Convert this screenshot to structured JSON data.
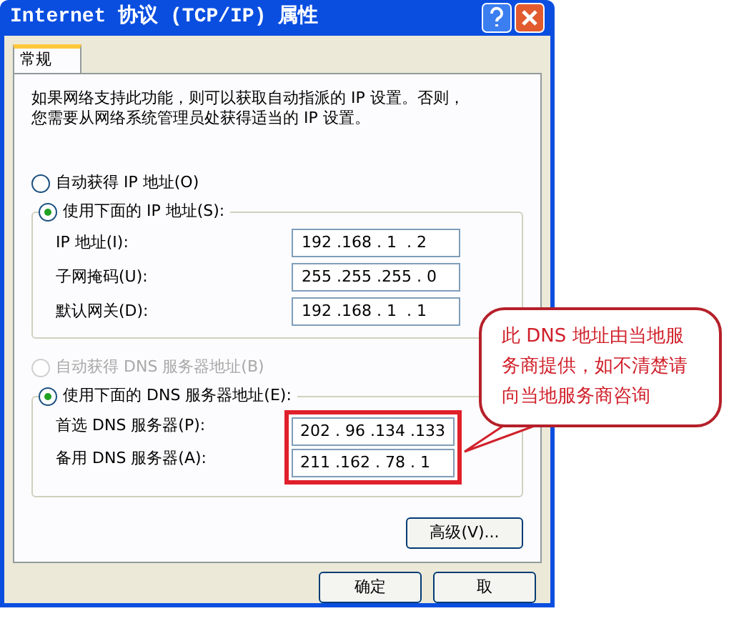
{
  "window": {
    "title": "Internet 协议 (TCP/IP) 属性"
  },
  "tabs": [
    {
      "label": "常规",
      "selected": true
    }
  ],
  "description": [
    "如果网络支持此功能，则可以获取自动指派的 IP 设置。否则，",
    "您需要从网络系统管理员处获得适当的 IP 设置。"
  ],
  "ip_options": [
    {
      "label": "自动获得 IP 地址(O)",
      "selected": false,
      "disabled": false
    },
    {
      "label": "使用下面的 IP 地址(S):",
      "selected": true,
      "disabled": false
    }
  ],
  "ip_fields": [
    {
      "label": "IP 地址(I):",
      "value": "192 .168 . 1  . 2"
    },
    {
      "label": "子网掩码(U):",
      "value": "255 .255 .255 . 0"
    },
    {
      "label": "默认网关(D):",
      "value": "192 .168 . 1  . 1"
    }
  ],
  "dns_options": [
    {
      "label": "自动获得 DNS 服务器地址(B)",
      "selected": false,
      "disabled": true
    },
    {
      "label": "使用下面的 DNS 服务器地址(E):",
      "selected": true,
      "disabled": false
    }
  ],
  "dns_fields": [
    {
      "label": "首选 DNS 服务器(P):",
      "value": "202 . 96 .134 .133"
    },
    {
      "label": "备用 DNS 服务器(A):",
      "value": "211 .162 . 78 . 1"
    }
  ],
  "advanced_button": "高级(V)...",
  "buttons": [
    "确定",
    "取"
  ],
  "callout": "此 DNS 地址由当地服务商提供，如不清楚请向当地服务商咨询"
}
